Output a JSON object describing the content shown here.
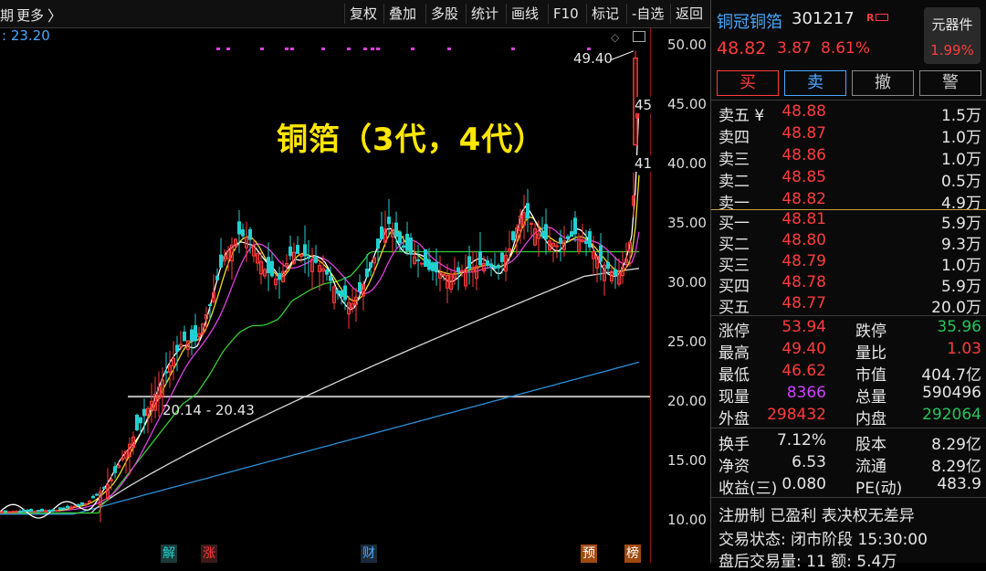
{
  "toolbar": {
    "period_label": "期",
    "more_label": "更多",
    "buttons": [
      "复权",
      "叠加",
      "多股",
      "统计",
      "画线",
      "F10",
      "标记",
      "-自选",
      "返回"
    ]
  },
  "ma_label": ": 23.20",
  "headline": "铜箔（3代，4代）",
  "high_label": "49.40",
  "range_label": "20.14 - 20.43",
  "y_axis_ticks": [
    "50.00",
    "45.00",
    "40.00",
    "35.00",
    "30.00",
    "25.00",
    "20.00",
    "15.00",
    "10.00"
  ],
  "axis_overlay_labels": [
    "45",
    "41"
  ],
  "markers": [
    "解",
    "涨",
    "财",
    "预",
    "榜"
  ],
  "colors": {
    "up": "#ff3b3b",
    "down": "#22d0d0",
    "accent": "#4aa8ff",
    "headline": "#ffe600",
    "down_value": "#22c55e"
  },
  "stock": {
    "name": "铜冠铜箔",
    "code": "301217",
    "tag": "R",
    "price": "48.82",
    "change": "3.87",
    "change_pct": "8.61%"
  },
  "sector": {
    "name": "元器件",
    "pct": "1.99%"
  },
  "actions": [
    "买",
    "卖",
    "撤",
    "警"
  ],
  "sell_orders": [
    {
      "label": "卖五 ¥",
      "price": "48.88",
      "volume": "1.5万"
    },
    {
      "label": "卖四",
      "price": "48.87",
      "volume": "1.0万"
    },
    {
      "label": "卖三",
      "price": "48.86",
      "volume": "1.0万"
    },
    {
      "label": "卖二",
      "price": "48.85",
      "volume": "0.5万"
    },
    {
      "label": "卖一",
      "price": "48.82",
      "volume": "4.9万"
    }
  ],
  "buy_orders": [
    {
      "label": "买一",
      "price": "48.81",
      "volume": "5.9万"
    },
    {
      "label": "买二",
      "price": "48.80",
      "volume": "9.3万"
    },
    {
      "label": "买三",
      "price": "48.79",
      "volume": "1.0万"
    },
    {
      "label": "买四",
      "price": "48.78",
      "volume": "5.9万"
    },
    {
      "label": "买五",
      "price": "48.77",
      "volume": "20.0万"
    }
  ],
  "stats": [
    {
      "l1": "涨停",
      "v1": "53.94",
      "v1c": "#ff3b3b",
      "l2": "跌停",
      "v2": "35.96",
      "v2c": "#22c55e"
    },
    {
      "l1": "最高",
      "v1": "49.40",
      "v1c": "#ff3b3b",
      "l2": "量比",
      "v2": "1.03",
      "v2c": "#ff3b3b"
    },
    {
      "l1": "最低",
      "v1": "46.62",
      "v1c": "#ff3b3b",
      "l2": "市值",
      "v2": "404.7亿",
      "v2c": "#e6e6e6"
    },
    {
      "l1": "现量",
      "v1": "8366",
      "v1c": "#d040ff",
      "l2": "总量",
      "v2": "590496",
      "v2c": "#e6e6e6"
    },
    {
      "l1": "外盘",
      "v1": "298432",
      "v1c": "#ff3b3b",
      "l2": "内盘",
      "v2": "292064",
      "v2c": "#22c55e"
    }
  ],
  "fundamentals": [
    {
      "l1": "换手",
      "v1": "7.12%",
      "l2": "股本",
      "v2": "8.29亿"
    },
    {
      "l1": "净资",
      "v1": "6.53",
      "l2": "流通",
      "v2": "8.29亿"
    },
    {
      "l1": "收益(三)",
      "v1": "0.080",
      "l2": "PE(动)",
      "v2": "483.9"
    }
  ],
  "info": {
    "line1": "注册制 已盈利 表决权无差异",
    "line2": "交易状态: 闭市阶段 15:30:00",
    "line3": "盘后交易量: 11  额: 5.4万"
  }
}
